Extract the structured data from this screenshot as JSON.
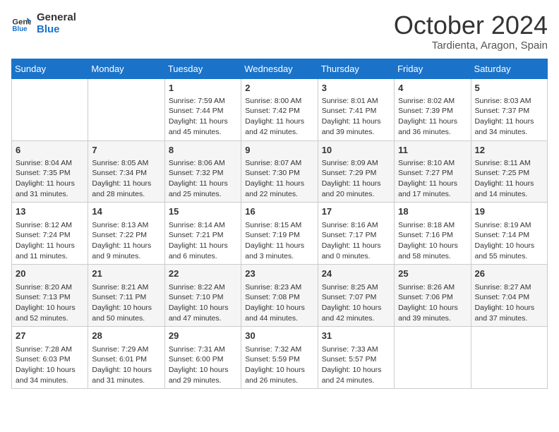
{
  "logo": {
    "line1": "General",
    "line2": "Blue"
  },
  "title": "October 2024",
  "subtitle": "Tardienta, Aragon, Spain",
  "days_of_week": [
    "Sunday",
    "Monday",
    "Tuesday",
    "Wednesday",
    "Thursday",
    "Friday",
    "Saturday"
  ],
  "weeks": [
    [
      {
        "day": "",
        "sunrise": "",
        "sunset": "",
        "daylight": ""
      },
      {
        "day": "",
        "sunrise": "",
        "sunset": "",
        "daylight": ""
      },
      {
        "day": "1",
        "sunrise": "Sunrise: 7:59 AM",
        "sunset": "Sunset: 7:44 PM",
        "daylight": "Daylight: 11 hours and 45 minutes."
      },
      {
        "day": "2",
        "sunrise": "Sunrise: 8:00 AM",
        "sunset": "Sunset: 7:42 PM",
        "daylight": "Daylight: 11 hours and 42 minutes."
      },
      {
        "day": "3",
        "sunrise": "Sunrise: 8:01 AM",
        "sunset": "Sunset: 7:41 PM",
        "daylight": "Daylight: 11 hours and 39 minutes."
      },
      {
        "day": "4",
        "sunrise": "Sunrise: 8:02 AM",
        "sunset": "Sunset: 7:39 PM",
        "daylight": "Daylight: 11 hours and 36 minutes."
      },
      {
        "day": "5",
        "sunrise": "Sunrise: 8:03 AM",
        "sunset": "Sunset: 7:37 PM",
        "daylight": "Daylight: 11 hours and 34 minutes."
      }
    ],
    [
      {
        "day": "6",
        "sunrise": "Sunrise: 8:04 AM",
        "sunset": "Sunset: 7:35 PM",
        "daylight": "Daylight: 11 hours and 31 minutes."
      },
      {
        "day": "7",
        "sunrise": "Sunrise: 8:05 AM",
        "sunset": "Sunset: 7:34 PM",
        "daylight": "Daylight: 11 hours and 28 minutes."
      },
      {
        "day": "8",
        "sunrise": "Sunrise: 8:06 AM",
        "sunset": "Sunset: 7:32 PM",
        "daylight": "Daylight: 11 hours and 25 minutes."
      },
      {
        "day": "9",
        "sunrise": "Sunrise: 8:07 AM",
        "sunset": "Sunset: 7:30 PM",
        "daylight": "Daylight: 11 hours and 22 minutes."
      },
      {
        "day": "10",
        "sunrise": "Sunrise: 8:09 AM",
        "sunset": "Sunset: 7:29 PM",
        "daylight": "Daylight: 11 hours and 20 minutes."
      },
      {
        "day": "11",
        "sunrise": "Sunrise: 8:10 AM",
        "sunset": "Sunset: 7:27 PM",
        "daylight": "Daylight: 11 hours and 17 minutes."
      },
      {
        "day": "12",
        "sunrise": "Sunrise: 8:11 AM",
        "sunset": "Sunset: 7:25 PM",
        "daylight": "Daylight: 11 hours and 14 minutes."
      }
    ],
    [
      {
        "day": "13",
        "sunrise": "Sunrise: 8:12 AM",
        "sunset": "Sunset: 7:24 PM",
        "daylight": "Daylight: 11 hours and 11 minutes."
      },
      {
        "day": "14",
        "sunrise": "Sunrise: 8:13 AM",
        "sunset": "Sunset: 7:22 PM",
        "daylight": "Daylight: 11 hours and 9 minutes."
      },
      {
        "day": "15",
        "sunrise": "Sunrise: 8:14 AM",
        "sunset": "Sunset: 7:21 PM",
        "daylight": "Daylight: 11 hours and 6 minutes."
      },
      {
        "day": "16",
        "sunrise": "Sunrise: 8:15 AM",
        "sunset": "Sunset: 7:19 PM",
        "daylight": "Daylight: 11 hours and 3 minutes."
      },
      {
        "day": "17",
        "sunrise": "Sunrise: 8:16 AM",
        "sunset": "Sunset: 7:17 PM",
        "daylight": "Daylight: 11 hours and 0 minutes."
      },
      {
        "day": "18",
        "sunrise": "Sunrise: 8:18 AM",
        "sunset": "Sunset: 7:16 PM",
        "daylight": "Daylight: 10 hours and 58 minutes."
      },
      {
        "day": "19",
        "sunrise": "Sunrise: 8:19 AM",
        "sunset": "Sunset: 7:14 PM",
        "daylight": "Daylight: 10 hours and 55 minutes."
      }
    ],
    [
      {
        "day": "20",
        "sunrise": "Sunrise: 8:20 AM",
        "sunset": "Sunset: 7:13 PM",
        "daylight": "Daylight: 10 hours and 52 minutes."
      },
      {
        "day": "21",
        "sunrise": "Sunrise: 8:21 AM",
        "sunset": "Sunset: 7:11 PM",
        "daylight": "Daylight: 10 hours and 50 minutes."
      },
      {
        "day": "22",
        "sunrise": "Sunrise: 8:22 AM",
        "sunset": "Sunset: 7:10 PM",
        "daylight": "Daylight: 10 hours and 47 minutes."
      },
      {
        "day": "23",
        "sunrise": "Sunrise: 8:23 AM",
        "sunset": "Sunset: 7:08 PM",
        "daylight": "Daylight: 10 hours and 44 minutes."
      },
      {
        "day": "24",
        "sunrise": "Sunrise: 8:25 AM",
        "sunset": "Sunset: 7:07 PM",
        "daylight": "Daylight: 10 hours and 42 minutes."
      },
      {
        "day": "25",
        "sunrise": "Sunrise: 8:26 AM",
        "sunset": "Sunset: 7:06 PM",
        "daylight": "Daylight: 10 hours and 39 minutes."
      },
      {
        "day": "26",
        "sunrise": "Sunrise: 8:27 AM",
        "sunset": "Sunset: 7:04 PM",
        "daylight": "Daylight: 10 hours and 37 minutes."
      }
    ],
    [
      {
        "day": "27",
        "sunrise": "Sunrise: 7:28 AM",
        "sunset": "Sunset: 6:03 PM",
        "daylight": "Daylight: 10 hours and 34 minutes."
      },
      {
        "day": "28",
        "sunrise": "Sunrise: 7:29 AM",
        "sunset": "Sunset: 6:01 PM",
        "daylight": "Daylight: 10 hours and 31 minutes."
      },
      {
        "day": "29",
        "sunrise": "Sunrise: 7:31 AM",
        "sunset": "Sunset: 6:00 PM",
        "daylight": "Daylight: 10 hours and 29 minutes."
      },
      {
        "day": "30",
        "sunrise": "Sunrise: 7:32 AM",
        "sunset": "Sunset: 5:59 PM",
        "daylight": "Daylight: 10 hours and 26 minutes."
      },
      {
        "day": "31",
        "sunrise": "Sunrise: 7:33 AM",
        "sunset": "Sunset: 5:57 PM",
        "daylight": "Daylight: 10 hours and 24 minutes."
      },
      {
        "day": "",
        "sunrise": "",
        "sunset": "",
        "daylight": ""
      },
      {
        "day": "",
        "sunrise": "",
        "sunset": "",
        "daylight": ""
      }
    ]
  ]
}
